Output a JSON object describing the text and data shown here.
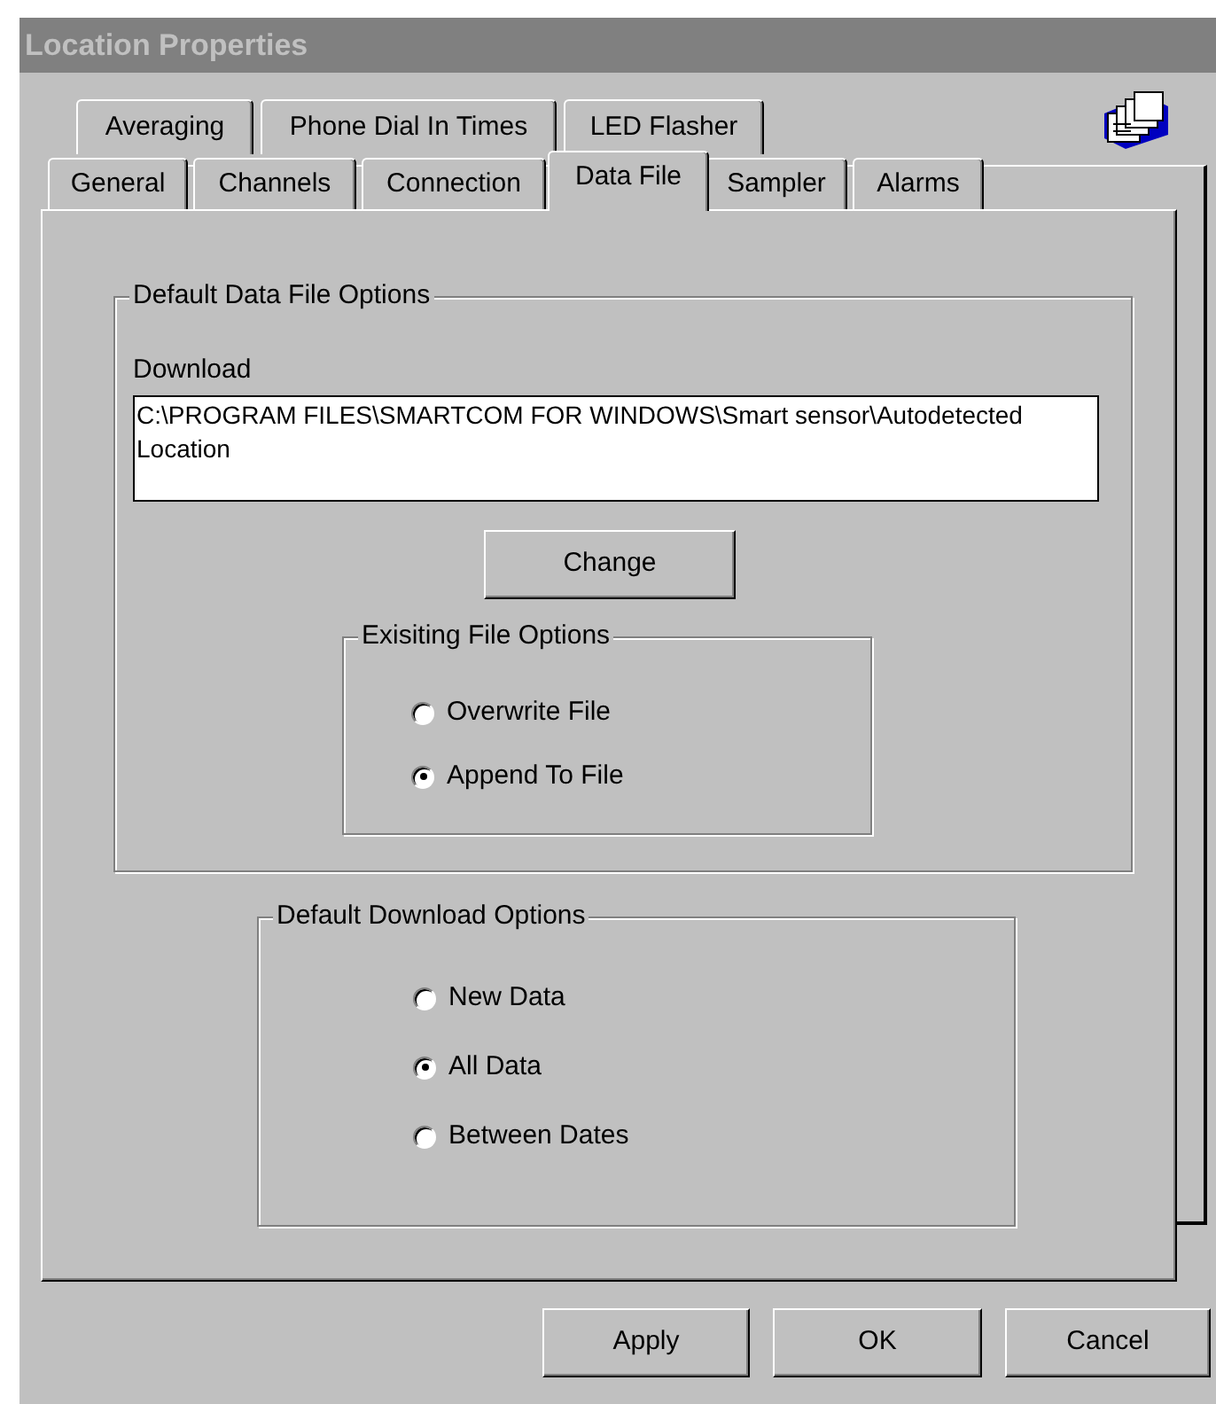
{
  "window": {
    "title": "Location Properties"
  },
  "tab_rows": [
    [
      {
        "label": "Averaging",
        "selected": false
      },
      {
        "label": "Phone Dial In Times",
        "selected": false
      },
      {
        "label": "LED Flasher",
        "selected": false
      }
    ],
    [
      {
        "label": "General",
        "selected": false
      },
      {
        "label": "Channels",
        "selected": false
      },
      {
        "label": "Connection",
        "selected": false
      },
      {
        "label": "Data File",
        "selected": true
      },
      {
        "label": "Sampler",
        "selected": false
      },
      {
        "label": "Alarms",
        "selected": false
      }
    ]
  ],
  "data_file_options": {
    "title": "Default Data File Options",
    "download_label": "Download",
    "download_path": "C:\\PROGRAM FILES\\SMARTCOM FOR WINDOWS\\Smart sensor\\Autodetected Location",
    "change_button": "Change",
    "existing_file_options": {
      "title": "Exisiting File Options",
      "options": [
        {
          "label": "Overwrite File",
          "selected": false
        },
        {
          "label": "Append To File",
          "selected": true
        }
      ]
    }
  },
  "download_options": {
    "title": "Default Download Options",
    "options": [
      {
        "label": "New Data",
        "selected": false
      },
      {
        "label": "All Data",
        "selected": true
      },
      {
        "label": "Between Dates",
        "selected": false
      }
    ]
  },
  "buttons": [
    "Apply",
    "OK",
    "Cancel"
  ]
}
